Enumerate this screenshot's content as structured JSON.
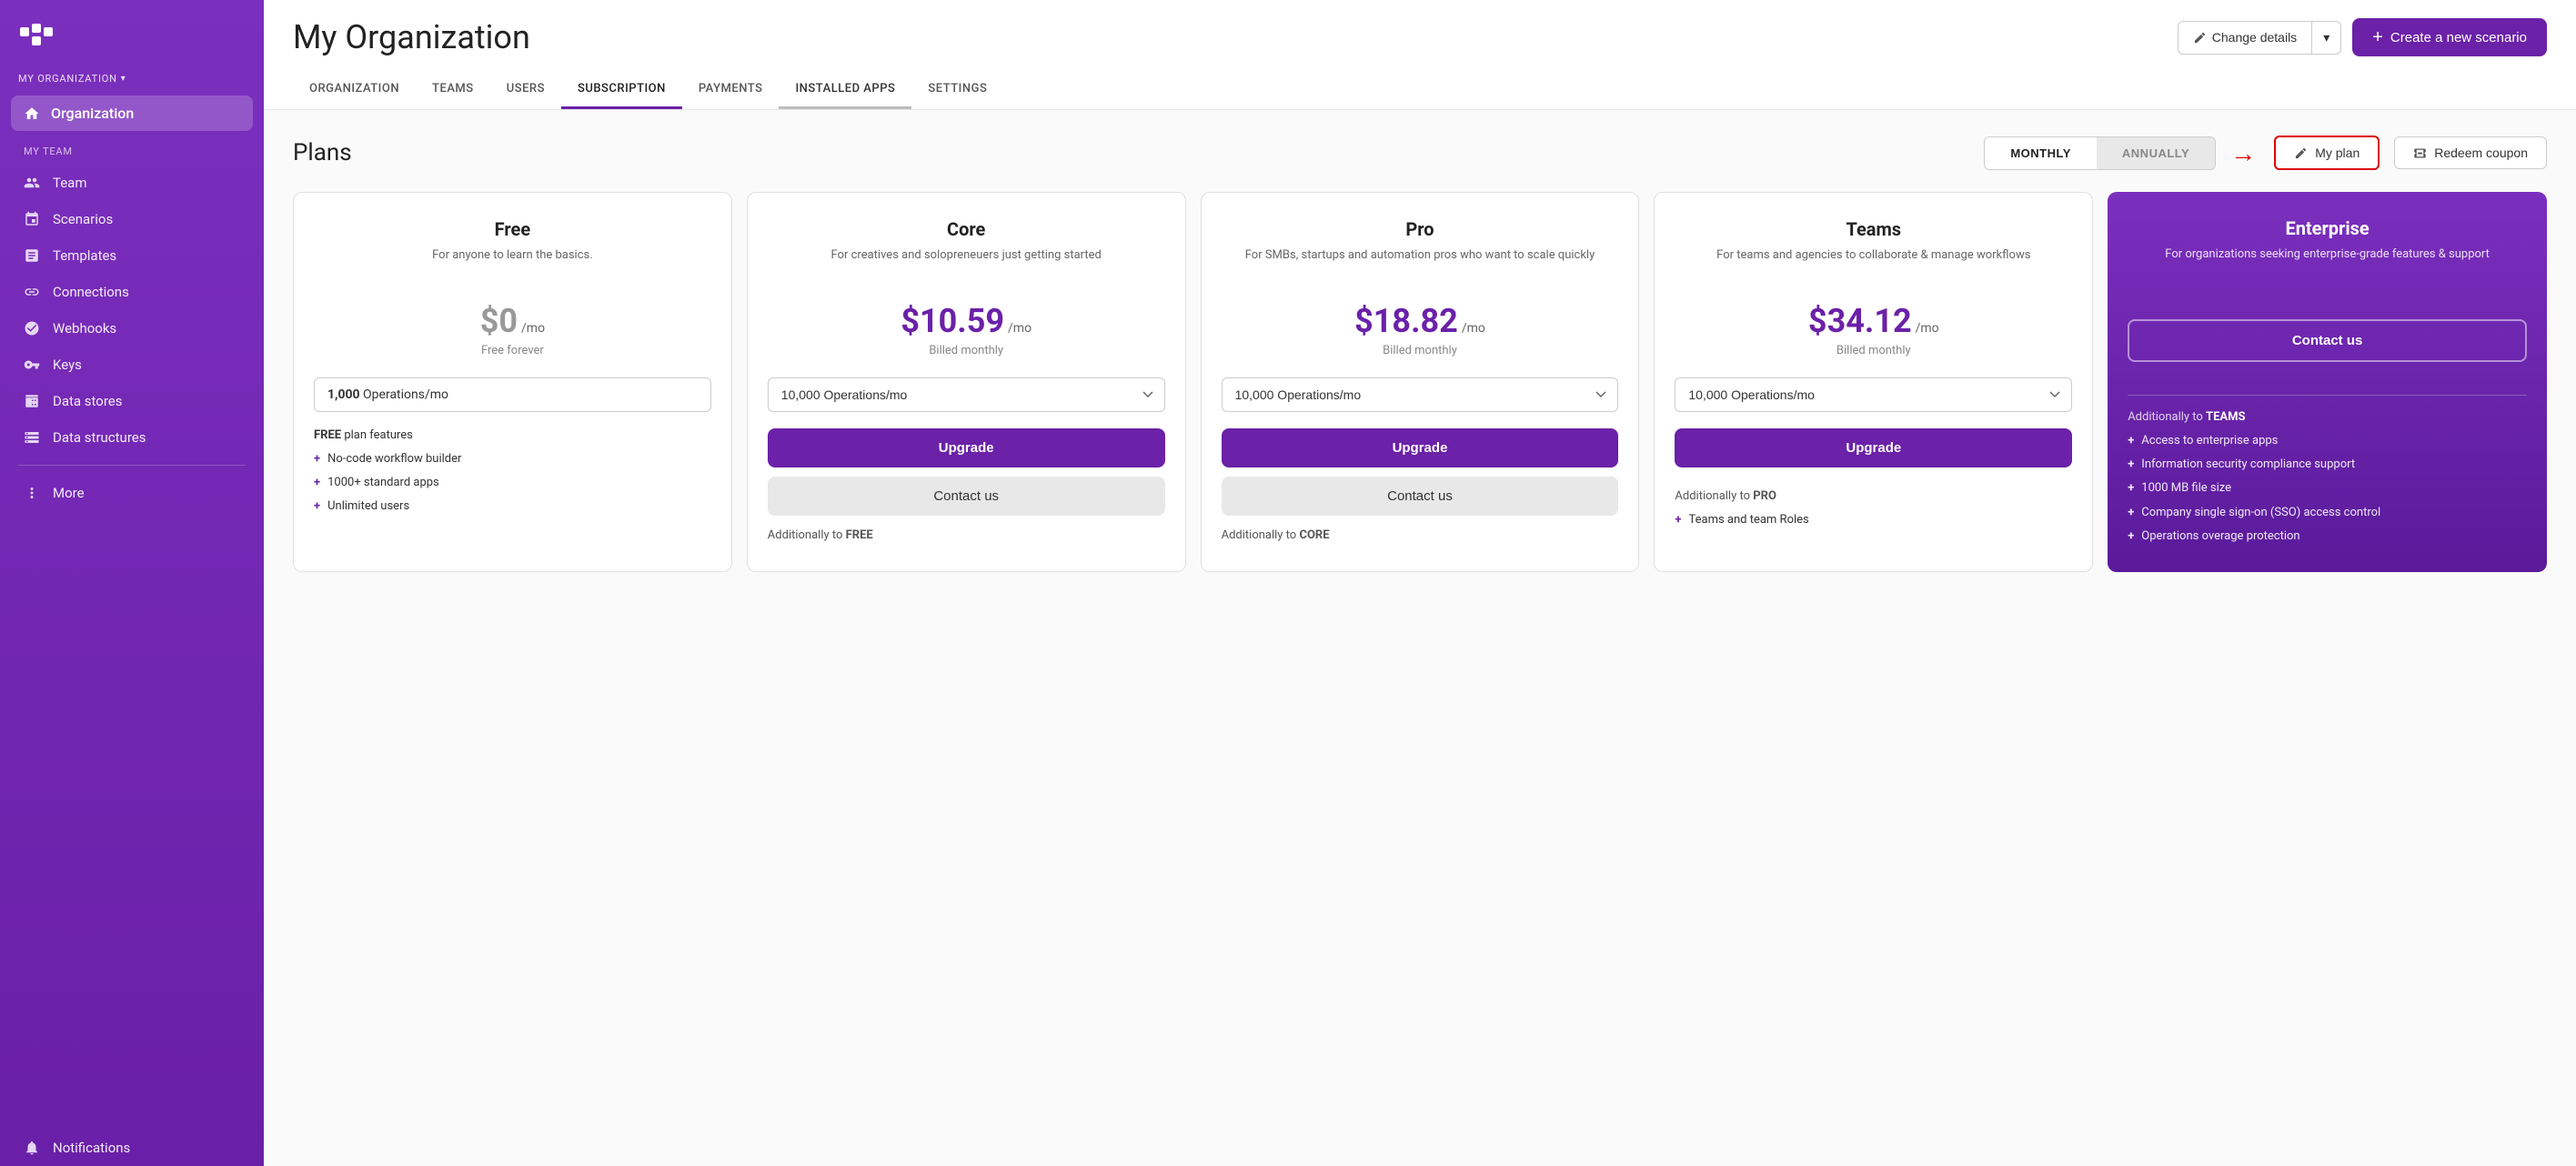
{
  "sidebar": {
    "logo_alt": "Make logo",
    "org_section_label": "MY ORGANIZATION",
    "active_item": "Organization",
    "my_team_label": "MY TEAM",
    "nav_items": [
      {
        "id": "team",
        "label": "Team"
      },
      {
        "id": "scenarios",
        "label": "Scenarios"
      },
      {
        "id": "templates",
        "label": "Templates"
      },
      {
        "id": "connections",
        "label": "Connections"
      },
      {
        "id": "webhooks",
        "label": "Webhooks"
      },
      {
        "id": "keys",
        "label": "Keys"
      },
      {
        "id": "data-stores",
        "label": "Data stores"
      },
      {
        "id": "data-structures",
        "label": "Data structures"
      }
    ],
    "more_label": "More",
    "notifications_label": "Notifications"
  },
  "header": {
    "page_title": "My Organization",
    "change_details_label": "Change details",
    "create_scenario_label": "Create a new scenario",
    "tabs": [
      {
        "id": "organization",
        "label": "ORGANIZATION"
      },
      {
        "id": "teams",
        "label": "TEAMS"
      },
      {
        "id": "users",
        "label": "USERS"
      },
      {
        "id": "subscription",
        "label": "SUBSCRIPTION",
        "active": true
      },
      {
        "id": "payments",
        "label": "PAYMENTS"
      },
      {
        "id": "installed-apps",
        "label": "INSTALLED APPS"
      },
      {
        "id": "settings",
        "label": "SETTINGS"
      }
    ]
  },
  "plans": {
    "title": "Plans",
    "billing_monthly": "MONTHLY",
    "billing_annually": "ANNUALLY",
    "my_plan_label": "My plan",
    "redeem_coupon_label": "Redeem coupon",
    "cards": [
      {
        "id": "free",
        "name": "Free",
        "desc": "For anyone to learn the basics.",
        "price": "$0",
        "price_period": "/mo",
        "billing_note": "Free forever",
        "ops": "1,000 Operations/mo",
        "ops_type": "static",
        "features_title_pre": "FREE",
        "features_title_post": "plan features",
        "features": [
          "No-code workflow builder",
          "1000+ standard apps",
          "Unlimited users"
        ]
      },
      {
        "id": "core",
        "name": "Core",
        "desc": "For creatives and solopreneuers just getting started",
        "price": "$10.59",
        "price_period": "/mo",
        "billing_note": "Billed monthly",
        "ops": "10,000",
        "ops_type": "select",
        "ops_suffix": "Operations/mo",
        "upgrade_label": "Upgrade",
        "contact_label": "Contact us",
        "additionally_pre": "Additionally to",
        "additionally_bold": "FREE"
      },
      {
        "id": "pro",
        "name": "Pro",
        "desc": "For SMBs, startups and automation pros who want to scale quickly",
        "price": "$18.82",
        "price_period": "/mo",
        "billing_note": "Billed monthly",
        "ops": "10,000",
        "ops_type": "select",
        "ops_suffix": "Operations/mo",
        "upgrade_label": "Upgrade",
        "contact_label": "Contact us",
        "additionally_pre": "Additionally to",
        "additionally_bold": "CORE"
      },
      {
        "id": "teams",
        "name": "Teams",
        "desc": "For teams and agencies to collaborate & manage workflows",
        "price": "$34.12",
        "price_period": "/mo",
        "billing_note": "Billed monthly",
        "ops": "10,000",
        "ops_type": "select",
        "ops_suffix": "Operations/mo",
        "upgrade_label": "Upgrade",
        "additionally_pre": "Additionally to",
        "additionally_bold": "PRO",
        "features": [
          "Teams and team Roles"
        ]
      },
      {
        "id": "enterprise",
        "name": "Enterprise",
        "desc": "For organizations seeking enterprise-grade features & support",
        "contact_label": "Contact us",
        "additionally_pre": "Additionally to",
        "additionally_bold": "TEAMS",
        "features": [
          "Access to enterprise apps",
          "Information security compliance support",
          "1000 MB file size",
          "Company single sign-on (SSO) access control",
          "Operations overage protection"
        ]
      }
    ]
  }
}
